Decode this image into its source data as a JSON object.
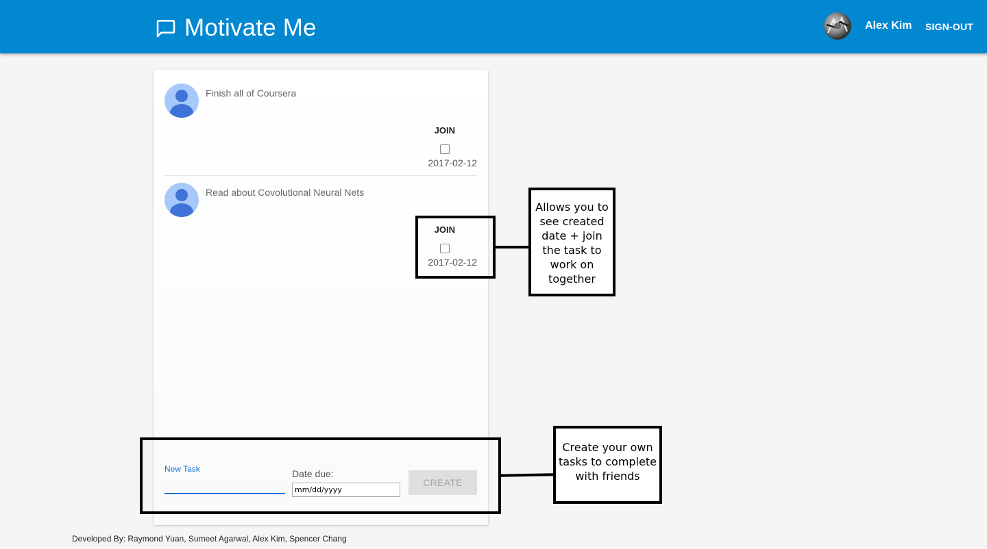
{
  "app": {
    "title": "Motivate Me",
    "icon": "chat-bubble-icon",
    "brand_color": "#0288d1",
    "background_color": "#f5f5f5"
  },
  "header": {
    "user_avatar": "user-photo",
    "user_name": "Alex Kim",
    "signout_label": "SIGN-OUT"
  },
  "tasks": [
    {
      "text": "Finish all of Coursera",
      "join_label": "JOIN",
      "joined": false,
      "date": "2017-02-12",
      "avatar_icon": "default-user-avatar-icon"
    },
    {
      "text": "Read about Covolutional Neural Nets",
      "join_label": "JOIN",
      "joined": false,
      "date": "2017-02-12",
      "avatar_icon": "default-user-avatar-icon"
    }
  ],
  "new_task_form": {
    "task_label": "New Task",
    "task_value": "",
    "date_label": "Date due:",
    "date_placeholder": "mm/dd/yyyy",
    "create_label": "CREATE",
    "accent_color": "#1976d2"
  },
  "annotations": {
    "join_note": "Allows you to see created date + join the task to work on together",
    "create_note": "Create your own tasks to complete with friends"
  },
  "footer": {
    "text": "Developed By: Raymond Yuan, Sumeet Agarwal, Alex Kim, Spencer Chang"
  }
}
